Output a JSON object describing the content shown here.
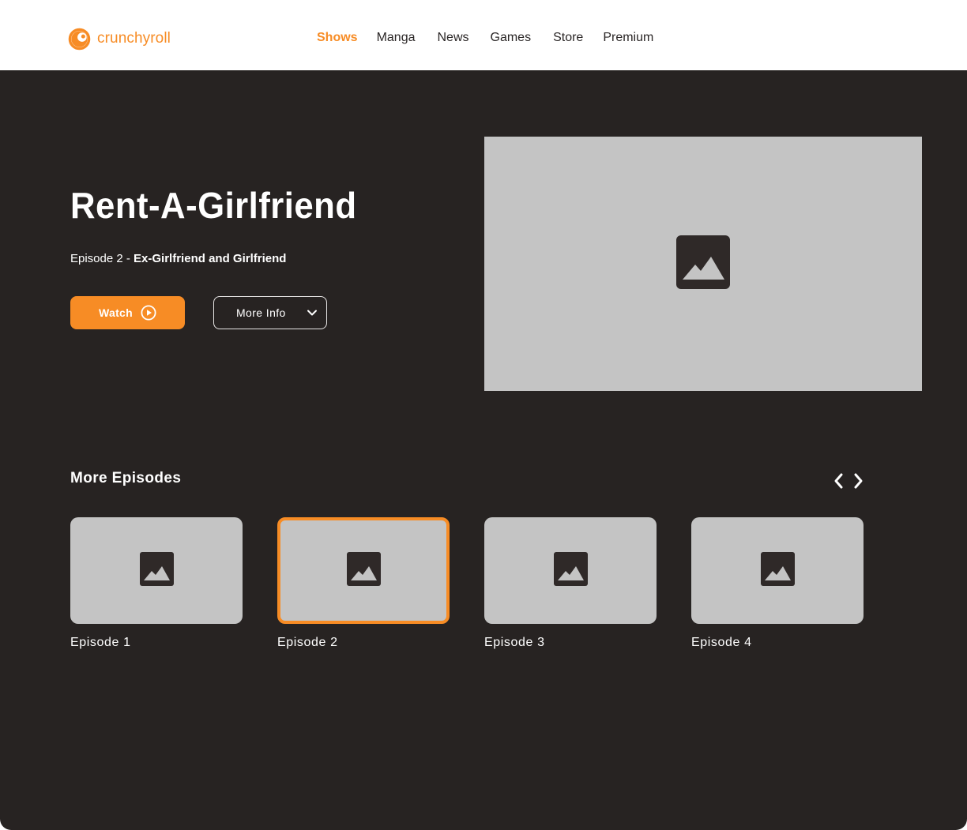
{
  "colors": {
    "accent": "#f78c25",
    "dark_bg": "#272322",
    "placeholder": "#c4c4c4",
    "header_bg": "#ffffff"
  },
  "header": {
    "logo_icon": "crunchyroll-logo-icon",
    "logo_text": "crunchyroll",
    "nav": [
      {
        "label": "Shows",
        "active": true
      },
      {
        "label": "Manga",
        "active": false
      },
      {
        "label": "News",
        "active": false
      },
      {
        "label": "Games",
        "active": false
      },
      {
        "label": "Store",
        "active": false
      },
      {
        "label": "Premium",
        "active": false
      }
    ]
  },
  "hero": {
    "title": "Rent-A-Girlfriend",
    "episode_prefix": "Episode 2 - ",
    "episode_title": "Ex-Girlfriend and Girlfriend",
    "watch_label": "Watch",
    "watch_icon": "play-circle-icon",
    "more_info_label": "More Info",
    "more_info_icon": "chevron-down-icon",
    "image_icon": "image-placeholder-icon"
  },
  "episodes": {
    "title": "More Episodes",
    "prev_icon": "chevron-left-icon",
    "next_icon": "chevron-right-icon",
    "items": [
      {
        "label": "Episode 1",
        "selected": false
      },
      {
        "label": "Episode 2",
        "selected": true
      },
      {
        "label": "Episode 3",
        "selected": false
      },
      {
        "label": "Episode 4",
        "selected": false
      }
    ]
  }
}
